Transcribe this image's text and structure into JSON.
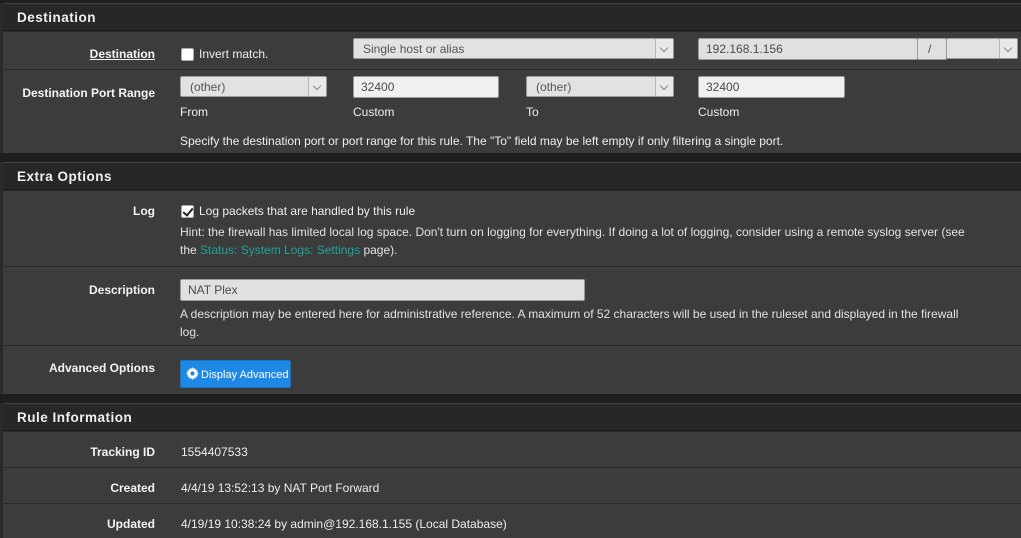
{
  "destination": {
    "header": "Destination",
    "label": "Destination",
    "invert_label": "Invert match.",
    "type_value": "Single host or alias",
    "address_value": "192.168.1.156",
    "slash": "/",
    "port_range_label": "Destination Port Range",
    "from_select": "(other)",
    "from_custom": "32400",
    "to_select": "(other)",
    "to_custom": "32400",
    "from_caption": "From",
    "custom_caption": "Custom",
    "to_caption": "To",
    "custom2_caption": "Custom",
    "help": "Specify the destination port or port range for this rule. The \"To\" field may be left empty if only filtering a single port."
  },
  "extra": {
    "header": "Extra Options",
    "log_label": "Log",
    "log_checkbox_label": "Log packets that are handled by this rule",
    "log_checked": true,
    "log_hint_1": "Hint: the firewall has limited local log space. Don't turn on logging for everything. If doing a lot of logging, consider using a remote syslog server (see",
    "log_hint_the": "the",
    "log_hint_link": "Status: System Logs: Settings",
    "log_hint_end": "page).",
    "description_label": "Description",
    "description_value": "NAT Plex",
    "description_help_1": "A description may be entered here for administrative reference. A maximum of 52 characters will be used in the ruleset and displayed in the firewall",
    "description_help_2": "log.",
    "advanced_label": "Advanced Options",
    "advanced_button": "Display Advanced"
  },
  "rule_info": {
    "header": "Rule Information",
    "tracking_label": "Tracking ID",
    "tracking_value": "1554407533",
    "created_label": "Created",
    "created_value": "4/4/19 13:52:13 by NAT Port Forward",
    "updated_label": "Updated",
    "updated_value": "4/19/19 10:38:24 by admin@192.168.1.155 (Local Database)"
  },
  "colors": {
    "link": "#1fa39a",
    "button": "#1e88e5",
    "panel_bg": "#3c3c3c",
    "header_bg": "#272727"
  }
}
